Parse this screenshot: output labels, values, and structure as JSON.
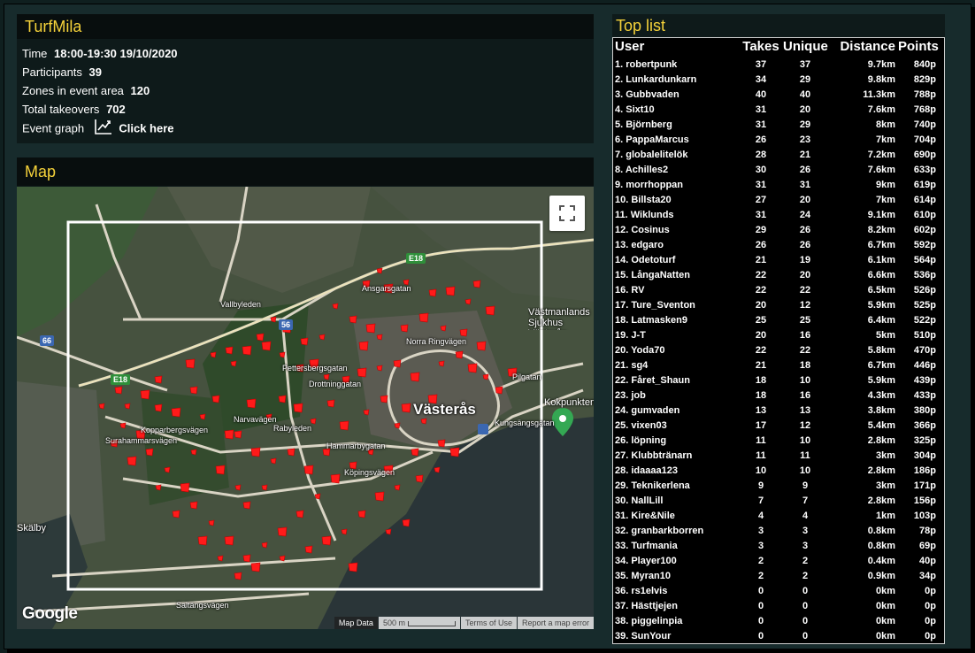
{
  "event": {
    "title": "TurfMila",
    "time_label": "Time",
    "time_value": "18:00-19:30 19/10/2020",
    "participants_label": "Participants",
    "participants_value": "39",
    "zones_label": "Zones in event area",
    "zones_value": "120",
    "takeovers_label": "Total takeovers",
    "takeovers_value": "702",
    "graph_label": "Event graph",
    "graph_icon": "chart-line-icon",
    "graph_link": "Click here"
  },
  "map": {
    "title": "Map",
    "city_label": "Västerås",
    "place_labels": [
      "Skälby",
      "Västmanlands Sjukhus Västerås",
      "Kokpunkten"
    ],
    "road_labels": [
      "Vallbyleden",
      "Norra Ringvägen",
      "Hammarbygatan",
      "Köpingsvägen",
      "Saltängsvägen",
      "Rabyleden",
      "Pilgatan",
      "Kungsängsgatan",
      "Surahammarsvägen",
      "Drottninggatan",
      "Kopparbergsvägen",
      "Pettersbergsgatan",
      "Narvavägen",
      "Ansgarsgatan"
    ],
    "route_shields": [
      "E18",
      "56",
      "66",
      "E18"
    ],
    "attribution": {
      "logo": "Google",
      "map_data": "Map Data",
      "scale": "500 m",
      "terms": "Terms of Use",
      "report": "Report a map error"
    },
    "zone_color": "#ff1a1a",
    "area_border_color": "#ffffff"
  },
  "toplist": {
    "title": "Top list",
    "columns": [
      "User",
      "Takes",
      "Unique",
      "Distance",
      "Points"
    ],
    "rows": [
      [
        "1. robertpunk",
        "37",
        "37",
        "9.7km",
        "840p"
      ],
      [
        "2. Lunkardunkarn",
        "34",
        "29",
        "9.8km",
        "829p"
      ],
      [
        "3. Gubbvaden",
        "40",
        "40",
        "11.3km",
        "788p"
      ],
      [
        "4. Sixt10",
        "31",
        "20",
        "7.6km",
        "768p"
      ],
      [
        "5. Björnberg",
        "31",
        "29",
        "8km",
        "740p"
      ],
      [
        "6. PappaMarcus",
        "26",
        "23",
        "7km",
        "704p"
      ],
      [
        "7. globalelitelök",
        "28",
        "21",
        "7.2km",
        "690p"
      ],
      [
        "8. Achilles2",
        "30",
        "26",
        "7.6km",
        "633p"
      ],
      [
        "9. morrhoppan",
        "31",
        "31",
        "9km",
        "619p"
      ],
      [
        "10. Billsta20",
        "27",
        "20",
        "7km",
        "614p"
      ],
      [
        "11. Wiklunds",
        "31",
        "24",
        "9.1km",
        "610p"
      ],
      [
        "12. Cosinus",
        "29",
        "26",
        "8.2km",
        "602p"
      ],
      [
        "13. edgaro",
        "26",
        "26",
        "6.7km",
        "592p"
      ],
      [
        "14. Odetoturf",
        "21",
        "19",
        "6.1km",
        "564p"
      ],
      [
        "15. LångaNatten",
        "22",
        "20",
        "6.6km",
        "536p"
      ],
      [
        "16. RV",
        "22",
        "22",
        "6.5km",
        "526p"
      ],
      [
        "17. Ture_Sventon",
        "20",
        "12",
        "5.9km",
        "525p"
      ],
      [
        "18. Latmasken9",
        "25",
        "25",
        "6.4km",
        "522p"
      ],
      [
        "19. J-T",
        "20",
        "16",
        "5km",
        "510p"
      ],
      [
        "20. Yoda70",
        "22",
        "22",
        "5.8km",
        "470p"
      ],
      [
        "21. sg4",
        "21",
        "18",
        "6.7km",
        "446p"
      ],
      [
        "22. Fåret_Shaun",
        "18",
        "10",
        "5.9km",
        "439p"
      ],
      [
        "23. job",
        "18",
        "16",
        "4.3km",
        "433p"
      ],
      [
        "24. gumvaden",
        "13",
        "13",
        "3.8km",
        "380p"
      ],
      [
        "25. vixen03",
        "17",
        "12",
        "5.4km",
        "366p"
      ],
      [
        "26. löpning",
        "11",
        "10",
        "2.8km",
        "325p"
      ],
      [
        "27. Klubbtränarn",
        "11",
        "11",
        "3km",
        "304p"
      ],
      [
        "28. idaaaa123",
        "10",
        "10",
        "2.8km",
        "186p"
      ],
      [
        "29. Teknikerlena",
        "9",
        "9",
        "3km",
        "171p"
      ],
      [
        "30. NallLill",
        "7",
        "7",
        "2.8km",
        "156p"
      ],
      [
        "31. Kire&Nile",
        "4",
        "4",
        "1km",
        "103p"
      ],
      [
        "32. granbarkborren",
        "3",
        "3",
        "0.8km",
        "78p"
      ],
      [
        "33. Turfmania",
        "3",
        "3",
        "0.8km",
        "69p"
      ],
      [
        "34. Player100",
        "2",
        "2",
        "0.4km",
        "40p"
      ],
      [
        "35. Myran10",
        "2",
        "2",
        "0.9km",
        "34p"
      ],
      [
        "36. rs1elvis",
        "0",
        "0",
        "0km",
        "0p"
      ],
      [
        "37. Hästtjejen",
        "0",
        "0",
        "0km",
        "0p"
      ],
      [
        "38. piggelinpia",
        "0",
        "0",
        "0km",
        "0p"
      ],
      [
        "39. SunYour",
        "0",
        "0",
        "0km",
        "0p"
      ]
    ]
  }
}
